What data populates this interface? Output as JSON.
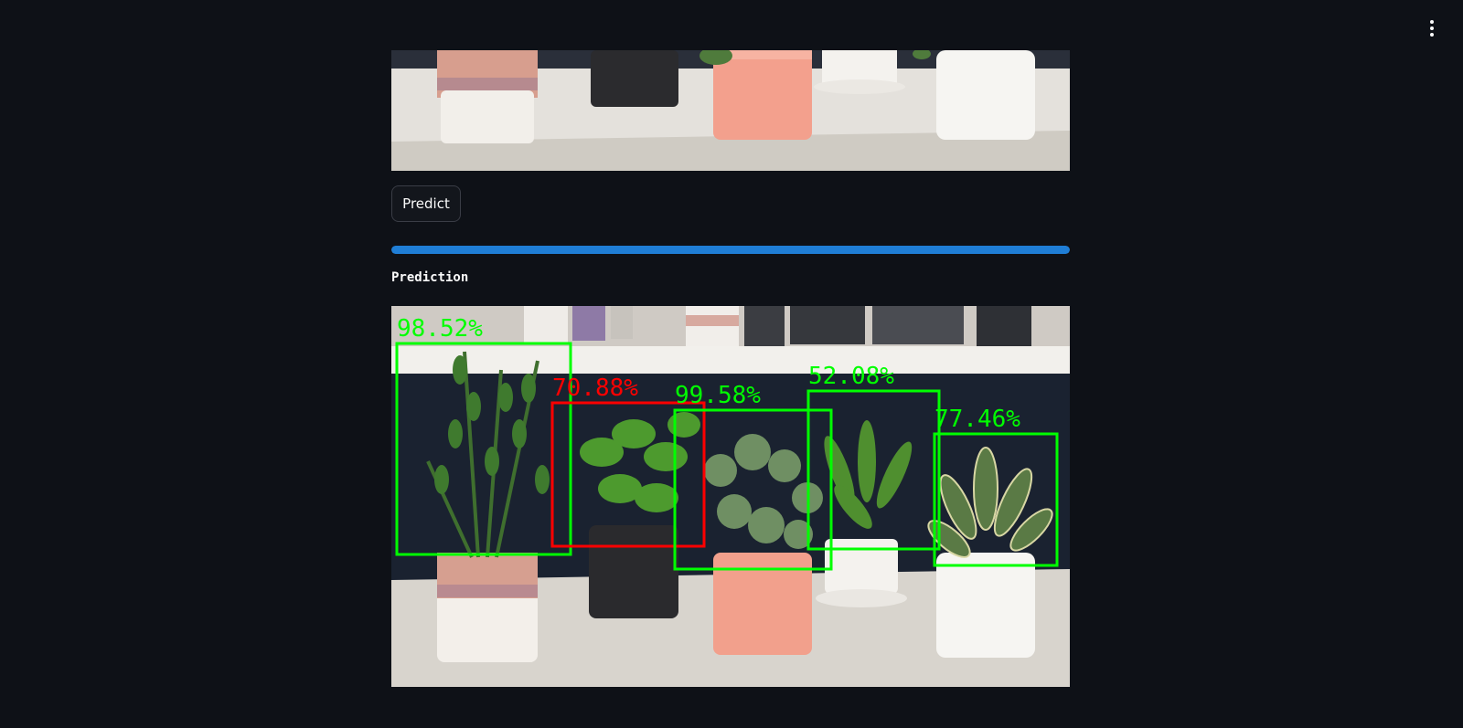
{
  "header": {
    "menu_icon": "vertical-ellipsis-icon"
  },
  "input_image": {
    "description_icon": "plant-photo"
  },
  "actions": {
    "predict_label": "Predict"
  },
  "progress": {
    "value": 1.0,
    "color": "#1f7ed6"
  },
  "result": {
    "caption": "Prediction",
    "detections": [
      {
        "confidence": "98.52%",
        "color": "#00ff00"
      },
      {
        "confidence": "70.88%",
        "color": "#ff0000"
      },
      {
        "confidence": "99.58%",
        "color": "#00ff00"
      },
      {
        "confidence": "52.08%",
        "color": "#00ff00"
      },
      {
        "confidence": "77.46%",
        "color": "#00ff00"
      }
    ]
  }
}
